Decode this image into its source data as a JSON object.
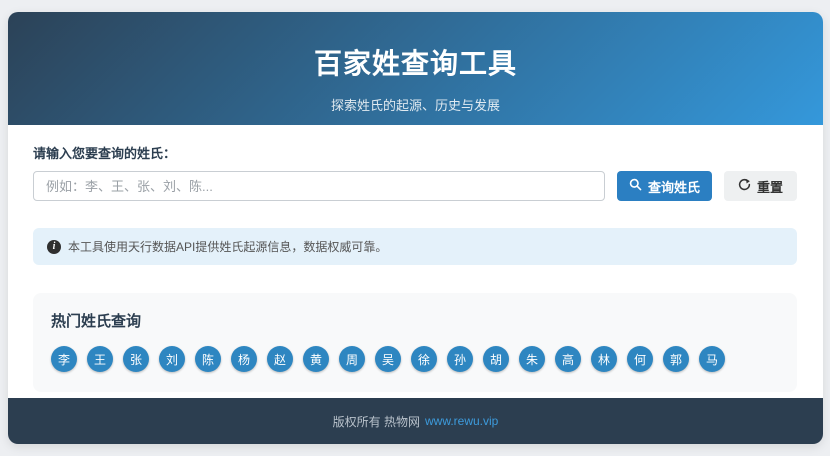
{
  "header": {
    "title": "百家姓查询工具",
    "subtitle": "探索姓氏的起源、历史与发展"
  },
  "search": {
    "label": "请输入您要查询的姓氏：",
    "value": "",
    "placeholder": "例如：李、王、张、刘、陈...",
    "query_button_label": "查询姓氏",
    "reset_button_label": "重置"
  },
  "notice": {
    "text": "本工具使用天行数据API提供姓氏起源信息，数据权威可靠。"
  },
  "hot": {
    "title": "热门姓氏查询",
    "surnames": [
      "李",
      "王",
      "张",
      "刘",
      "陈",
      "杨",
      "赵",
      "黄",
      "周",
      "吴",
      "徐",
      "孙",
      "胡",
      "朱",
      "高",
      "林",
      "何",
      "郭",
      "马"
    ]
  },
  "footer": {
    "copyright": "版权所有 热物网",
    "link_text": "www.rewu.vip"
  },
  "colors": {
    "header_gradient_start": "#2c4257",
    "header_gradient_end": "#3498db",
    "primary_button": "#2b7fc2",
    "surname_button": "#2e86c1",
    "notice_bg": "#e4f1fa",
    "footer_bg": "#2c3e50",
    "link": "#3d9bdc"
  }
}
